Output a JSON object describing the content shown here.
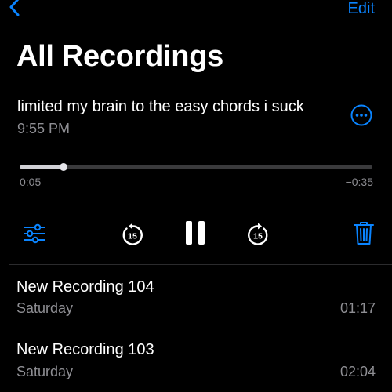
{
  "nav": {
    "back_icon": "chevron-left-icon",
    "edit_label": "Edit"
  },
  "page_title": "All Recordings",
  "active_recording": {
    "title": "limited my brain to the easy chords i suck",
    "time": "9:55 PM",
    "elapsed": "0:05",
    "remaining": "−0:35",
    "progress": 0.125
  },
  "controls": {
    "options_icon": "sliders-icon",
    "skip_back_icon": "skip-back-15-icon",
    "skip_back_seconds": "15",
    "pause_icon": "pause-icon",
    "skip_forward_icon": "skip-forward-15-icon",
    "skip_forward_seconds": "15",
    "delete_icon": "trash-icon"
  },
  "recordings": [
    {
      "name": "New Recording 104",
      "date": "Saturday",
      "duration": "01:17"
    },
    {
      "name": "New Recording 103",
      "date": "Saturday",
      "duration": "02:04"
    }
  ],
  "colors": {
    "accent": "#0a84ff",
    "background": "#000000",
    "secondary_text": "#8e8e93"
  }
}
